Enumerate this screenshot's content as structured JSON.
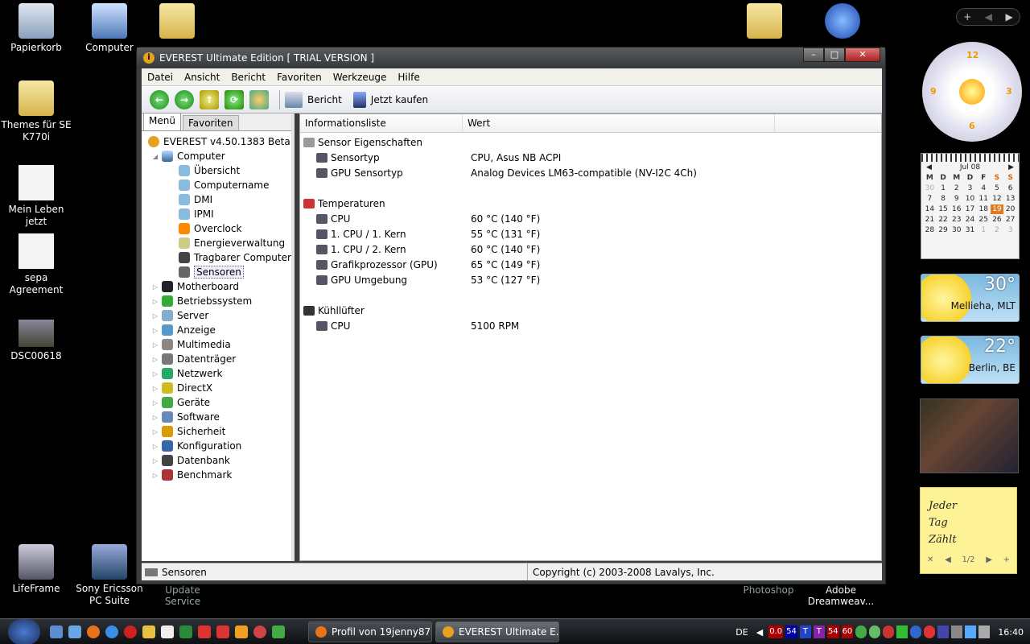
{
  "desktop": {
    "icons_left": [
      {
        "label": "Papierkorb"
      },
      {
        "label": "Computer"
      },
      {
        "label": "Themes für SE K770i"
      },
      {
        "label": "Mein Leben jetzt"
      },
      {
        "label": "sepa Agreement"
      },
      {
        "label": "DSC00618"
      },
      {
        "label": "LifeFrame"
      },
      {
        "label": "Sony Ericsson PC Suite"
      }
    ],
    "bottom_labels": {
      "update": "Update Service",
      "photoshop": "Photoshop",
      "dreamweaver": "Adobe Dreamweav..."
    }
  },
  "sidebar": {
    "calendar": {
      "month": "Jul 08",
      "days_header": [
        "M",
        "D",
        "M",
        "D",
        "F",
        "S",
        "S"
      ],
      "weeks": [
        [
          "30",
          "1",
          "2",
          "3",
          "4",
          "5",
          "6"
        ],
        [
          "7",
          "8",
          "9",
          "10",
          "11",
          "12",
          "13"
        ],
        [
          "14",
          "15",
          "16",
          "17",
          "18",
          "19",
          "20"
        ],
        [
          "21",
          "22",
          "23",
          "24",
          "25",
          "26",
          "27"
        ],
        [
          "28",
          "29",
          "30",
          "31",
          "1",
          "2",
          "3"
        ]
      ],
      "today": "19"
    },
    "weather": [
      {
        "temp": "30°",
        "city": "Mellieha, MLT"
      },
      {
        "temp": "22°",
        "city": "Berlin, BE"
      }
    ],
    "note": {
      "lines": [
        "Jeder",
        "Tag",
        "Zählt"
      ],
      "pager": "1/2"
    },
    "clock": {
      "numbers": [
        "12",
        "3",
        "6",
        "9"
      ]
    }
  },
  "window": {
    "title": "EVEREST Ultimate Edition  [ TRIAL VERSION ]",
    "menu": [
      "Datei",
      "Ansicht",
      "Bericht",
      "Favoriten",
      "Werkzeuge",
      "Hilfe"
    ],
    "toolbar": {
      "report_label": "Bericht",
      "buy_label": "Jetzt kaufen"
    },
    "tabs": {
      "menu": "Menü",
      "favorites": "Favoriten"
    },
    "tree": {
      "root": "EVEREST v4.50.1383 Beta",
      "computer": "Computer",
      "computer_children": [
        "Übersicht",
        "Computername",
        "DMI",
        "IPMI",
        "Overclock",
        "Energieverwaltung",
        "Tragbarer Computer",
        "Sensoren"
      ],
      "categories": [
        "Motherboard",
        "Betriebssystem",
        "Server",
        "Anzeige",
        "Multimedia",
        "Datenträger",
        "Netzwerk",
        "DirectX",
        "Geräte",
        "Software",
        "Sicherheit",
        "Konfiguration",
        "Datenbank",
        "Benchmark"
      ]
    },
    "columns": {
      "field": "Informationsliste",
      "value": "Wert"
    },
    "sections": {
      "sensor_props": {
        "title": "Sensor Eigenschaften",
        "rows": [
          {
            "k": "Sensortyp",
            "v": "CPU, Asus NB ACPI"
          },
          {
            "k": "GPU Sensortyp",
            "v": "Analog Devices LM63-compatible  (NV-I2C 4Ch)"
          }
        ]
      },
      "temps": {
        "title": "Temperaturen",
        "rows": [
          {
            "k": "CPU",
            "v": "60 °C  (140 °F)"
          },
          {
            "k": "1. CPU / 1. Kern",
            "v": "55 °C  (131 °F)"
          },
          {
            "k": "1. CPU / 2. Kern",
            "v": "60 °C  (140 °F)"
          },
          {
            "k": "Grafikprozessor (GPU)",
            "v": "65 °C  (149 °F)"
          },
          {
            "k": "GPU Umgebung",
            "v": "53 °C  (127 °F)"
          }
        ]
      },
      "fans": {
        "title": "Kühllüfter",
        "rows": [
          {
            "k": "CPU",
            "v": "5100 RPM"
          }
        ]
      }
    },
    "status": {
      "left": "Sensoren",
      "right": "Copyright (c) 2003-2008 Lavalys, Inc."
    }
  },
  "taskbar": {
    "tasks": [
      "Profil von 19jenny87...",
      "EVEREST Ultimate E..."
    ],
    "lang": "DE",
    "tray_values": [
      "0.0",
      "54",
      "T",
      "T",
      "54",
      "60"
    ],
    "time": "16:40"
  },
  "colors": {
    "accent": "#e07a1a",
    "window_frame": "#3a3c3f",
    "taskbar": "#1a1d22"
  }
}
